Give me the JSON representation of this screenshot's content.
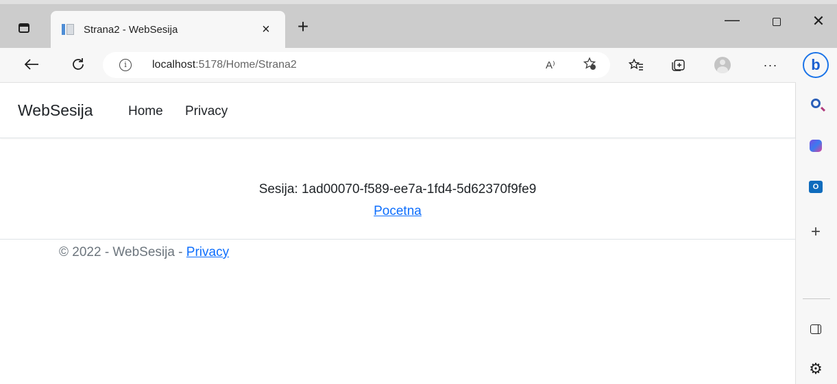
{
  "browser": {
    "tab_title": "Strana2 - WebSesija",
    "tab_close": "×",
    "new_tab": "+",
    "minimize": "—",
    "close_window": "✕",
    "url_host": "localhost",
    "url_path": ":5178/Home/Strana2",
    "read_aloud": "A⁾",
    "more": "···"
  },
  "site": {
    "brand": "WebSesija",
    "nav": {
      "home": "Home",
      "privacy": "Privacy"
    },
    "content": {
      "session_text": "Sesija: 1ad00070-f589-ee7a-1fd4-5d62370f9fe9",
      "link": "Pocetna"
    },
    "footer": {
      "copyright": "© 2022 - WebSesija - ",
      "privacy_link": "Privacy"
    }
  },
  "sidebar": {
    "bing": "b",
    "outlook": "O",
    "add": "+",
    "settings": "⚙"
  }
}
